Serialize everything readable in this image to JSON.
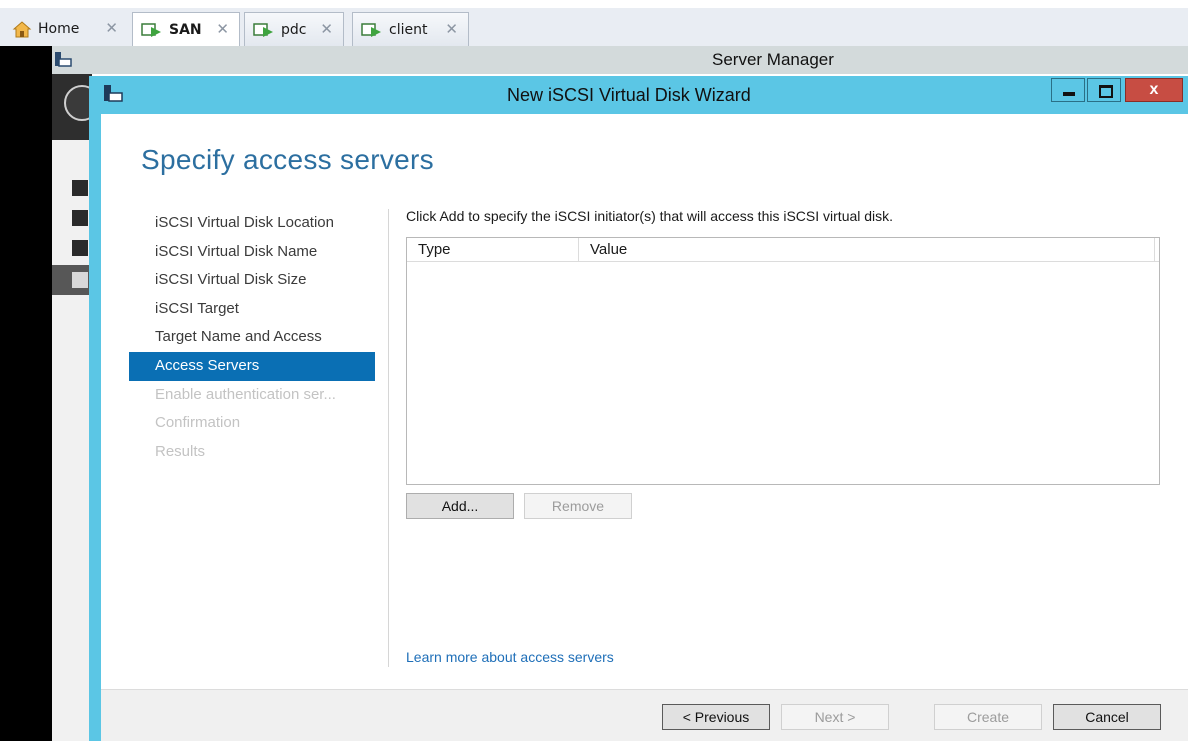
{
  "tabs": [
    {
      "label": "Home",
      "icon": "home-icon"
    },
    {
      "label": "SAN",
      "icon": "vm-icon"
    },
    {
      "label": "pdc",
      "icon": "vm-icon"
    },
    {
      "label": "client",
      "icon": "vm-icon"
    }
  ],
  "tab_close_glyph": "✕",
  "server_manager": {
    "title": "Server Manager"
  },
  "wizard": {
    "title": "New iSCSI Virtual Disk Wizard",
    "close_glyph": "x",
    "heading": "Specify access servers",
    "steps": [
      {
        "label": "iSCSI Virtual Disk Location",
        "state": "done"
      },
      {
        "label": "iSCSI Virtual Disk Name",
        "state": "done"
      },
      {
        "label": "iSCSI Virtual Disk Size",
        "state": "done"
      },
      {
        "label": "iSCSI Target",
        "state": "done"
      },
      {
        "label": "Target Name and Access",
        "state": "done"
      },
      {
        "label": "Access Servers",
        "state": "active"
      },
      {
        "label": "Enable authentication ser...",
        "state": "disabled"
      },
      {
        "label": "Confirmation",
        "state": "disabled"
      },
      {
        "label": "Results",
        "state": "disabled"
      }
    ],
    "instruction": "Click Add to specify the iSCSI initiator(s) that will access this iSCSI virtual disk.",
    "grid": {
      "columns": [
        "Type",
        "Value"
      ],
      "rows": []
    },
    "add_label": "Add...",
    "remove_label": "Remove",
    "learn_more": "Learn more about access servers",
    "footer": {
      "previous": "< Previous",
      "next": "Next >",
      "create": "Create",
      "cancel": "Cancel"
    }
  },
  "colors": {
    "accent": "#0a6fb4",
    "titlebar": "#5bc6e5",
    "heading": "#2c6fa0",
    "close": "#c74d43"
  }
}
